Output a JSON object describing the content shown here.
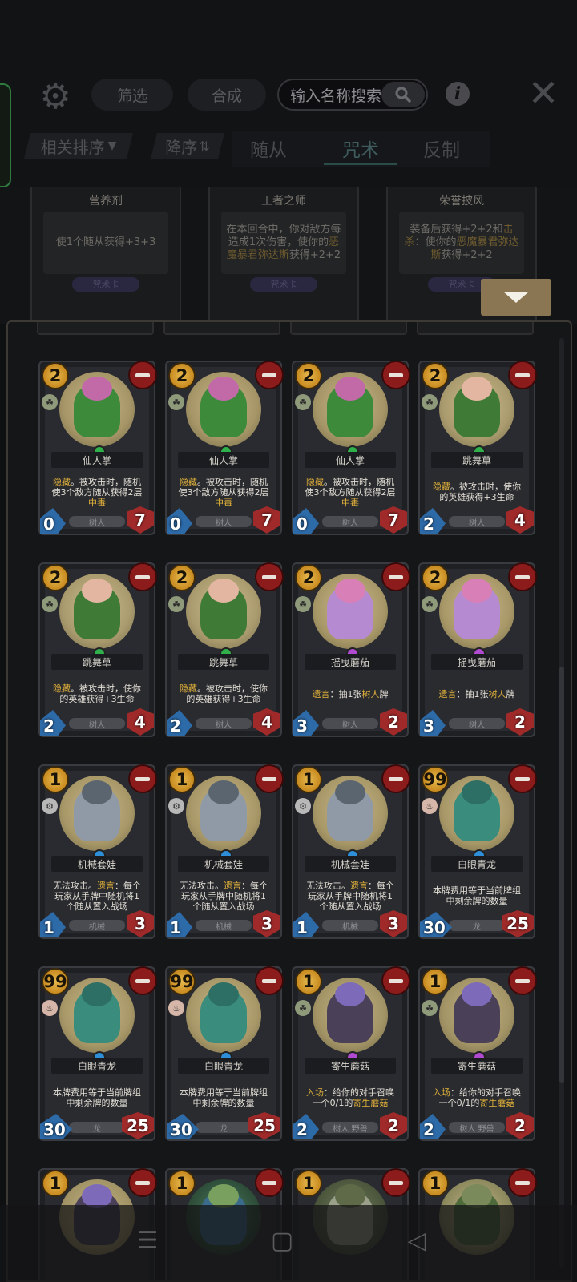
{
  "toolbar": {
    "filter_label": "筛选",
    "craft_label": "合成",
    "search_placeholder": "输入名称搜索"
  },
  "sorting": {
    "relevance_label": "相关排序",
    "order_label": "降序"
  },
  "tabs": [
    {
      "label": "随从",
      "active": false
    },
    {
      "label": "咒术",
      "active": true
    },
    {
      "label": "反制",
      "active": false
    }
  ],
  "deck_cards": [
    {
      "name": "营养剂",
      "text": "使1个随从获得+3+3",
      "type": "咒术卡"
    },
    {
      "name": "王者之师",
      "text_parts": [
        "在本回合中，你对敌方每造成1次伤害，使你的",
        "恶魔暴君弥达斯",
        "获得+2+2"
      ],
      "type": "咒术卡"
    },
    {
      "name": "荣誉披风",
      "text_parts": [
        "装备后获得+2+2和",
        "击杀",
        "：使你的",
        "恶魔暴君弥达斯",
        "获得+2+2"
      ],
      "type": "咒术卡"
    }
  ],
  "cards": [
    {
      "name": "仙人掌",
      "cost": "2",
      "tribe_icon": "plant",
      "text_parts": [
        "隐藏",
        "。被攻击时，随机使3个敌方随从获得2层",
        "中毒"
      ],
      "type": "树人",
      "attack": "0",
      "health": "7",
      "portrait": "cactus"
    },
    {
      "name": "仙人掌",
      "cost": "2",
      "tribe_icon": "plant",
      "text_parts": [
        "隐藏",
        "。被攻击时，随机使3个敌方随从获得2层",
        "中毒"
      ],
      "type": "树人",
      "attack": "0",
      "health": "7",
      "portrait": "cactus"
    },
    {
      "name": "仙人掌",
      "cost": "2",
      "tribe_icon": "plant",
      "text_parts": [
        "隐藏",
        "。被攻击时，随机使3个敌方随从获得2层",
        "中毒"
      ],
      "type": "树人",
      "attack": "0",
      "health": "7",
      "portrait": "cactus"
    },
    {
      "name": "跳舞草",
      "cost": "2",
      "tribe_icon": "plant",
      "text_parts": [
        "隐藏",
        "。被攻击时，使你的英雄获得+3生命",
        ""
      ],
      "type": "树人",
      "attack": "2",
      "health": "4",
      "portrait": "dancer"
    },
    {
      "name": "跳舞草",
      "cost": "2",
      "tribe_icon": "plant",
      "text_parts": [
        "隐藏",
        "。被攻击时，使你的英雄获得+3生命",
        ""
      ],
      "type": "树人",
      "attack": "2",
      "health": "4",
      "portrait": "dancer"
    },
    {
      "name": "跳舞草",
      "cost": "2",
      "tribe_icon": "plant",
      "text_parts": [
        "隐藏",
        "。被攻击时，使你的英雄获得+3生命",
        ""
      ],
      "type": "树人",
      "attack": "2",
      "health": "4",
      "portrait": "dancer"
    },
    {
      "name": "摇曳蘑茄",
      "cost": "2",
      "tribe_icon": "plant",
      "text_parts": [
        "遗言",
        "：抽1张",
        "树人",
        "牌"
      ],
      "type": "树人",
      "attack": "3",
      "health": "2",
      "portrait": "mushroom"
    },
    {
      "name": "摇曳蘑茄",
      "cost": "2",
      "tribe_icon": "plant",
      "text_parts": [
        "遗言",
        "：抽1张",
        "树人",
        "牌"
      ],
      "type": "树人",
      "attack": "3",
      "health": "2",
      "portrait": "mushroom"
    },
    {
      "name": "机械套娃",
      "cost": "1",
      "tribe_icon": "mech",
      "text_parts": [
        "无法攻击。",
        "遗言",
        "：每个玩家从手牌中随机将1个随从置入战场"
      ],
      "type": "机械",
      "attack": "1",
      "health": "3",
      "portrait": "mech"
    },
    {
      "name": "机械套娃",
      "cost": "1",
      "tribe_icon": "mech",
      "text_parts": [
        "无法攻击。",
        "遗言",
        "：每个玩家从手牌中随机将1个随从置入战场"
      ],
      "type": "机械",
      "attack": "1",
      "health": "3",
      "portrait": "mech"
    },
    {
      "name": "机械套娃",
      "cost": "1",
      "tribe_icon": "mech",
      "text_parts": [
        "无法攻击。",
        "遗言",
        "：每个玩家从手牌中随机将1个随从置入战场"
      ],
      "type": "机械",
      "attack": "1",
      "health": "3",
      "portrait": "mech"
    },
    {
      "name": "白眼青龙",
      "cost": "99",
      "tribe_icon": "dragon",
      "text_parts": [
        "本牌费用等于当前牌组中剩余牌的数量"
      ],
      "type": "龙",
      "attack": "30",
      "health": "25",
      "portrait": "dragon"
    },
    {
      "name": "白眼青龙",
      "cost": "99",
      "tribe_icon": "dragon",
      "text_parts": [
        "本牌费用等于当前牌组中剩余牌的数量"
      ],
      "type": "龙",
      "attack": "30",
      "health": "25",
      "portrait": "dragon"
    },
    {
      "name": "白眼青龙",
      "cost": "99",
      "tribe_icon": "dragon",
      "text_parts": [
        "本牌费用等于当前牌组中剩余牌的数量"
      ],
      "type": "龙",
      "attack": "30",
      "health": "25",
      "portrait": "dragon"
    },
    {
      "name": "寄生蘑菇",
      "cost": "1",
      "tribe_icon": "plant",
      "text_parts": [
        "入场",
        "：给你的对手召唤一个0/1的",
        "寄生蘑菇"
      ],
      "type": "树人 野兽",
      "attack": "2",
      "health": "2",
      "portrait": "parasite"
    },
    {
      "name": "寄生蘑菇",
      "cost": "1",
      "tribe_icon": "plant",
      "text_parts": [
        "入场",
        "：给你的对手召唤一个0/1的",
        "寄生蘑菇"
      ],
      "type": "树人 野兽",
      "attack": "2",
      "health": "2",
      "portrait": "parasite"
    },
    {
      "name": "",
      "cost": "1",
      "tribe_icon": "",
      "text_parts": [],
      "type": "",
      "attack": "",
      "health": "",
      "portrait": "parasite"
    },
    {
      "name": "",
      "cost": "1",
      "tribe_icon": "",
      "text_parts": [],
      "type": "",
      "attack": "",
      "health": "",
      "portrait": "storm"
    },
    {
      "name": "",
      "cost": "1",
      "tribe_icon": "",
      "text_parts": [],
      "type": "",
      "attack": "",
      "health": "",
      "portrait": "bones"
    },
    {
      "name": "",
      "cost": "1",
      "tribe_icon": "",
      "text_parts": [],
      "type": "",
      "attack": "",
      "health": "",
      "portrait": "ghost"
    }
  ],
  "colors": {
    "highlight": "#e0b03a",
    "cost_gold": "#d9a43a",
    "attack_blue": "#2d6aa8",
    "health_red": "#a02a2a",
    "collapse_button": "#8a7652"
  },
  "icons": {
    "settings": "gear-icon",
    "search": "search-icon",
    "info": "info-icon",
    "close": "close-icon",
    "collapse": "chevron-down-icon",
    "nav_menu": "menu-icon",
    "nav_home": "home-icon",
    "nav_back": "back-icon"
  }
}
